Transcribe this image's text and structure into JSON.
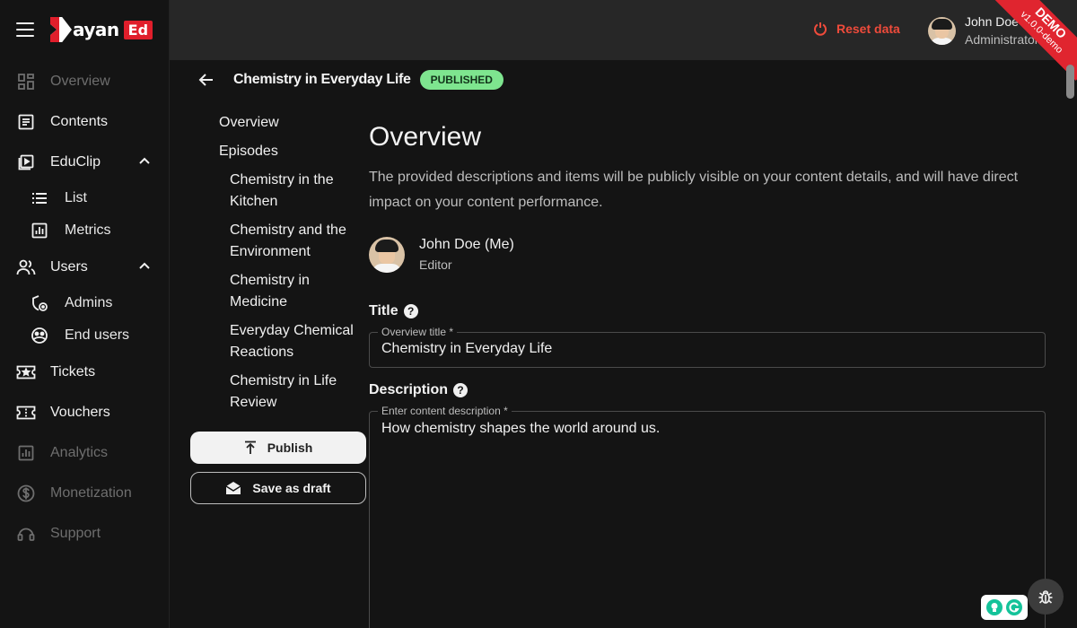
{
  "brand": {
    "logo_text": "ayan",
    "logo_badge": "Ed"
  },
  "sidebar": {
    "items": [
      {
        "label": "Overview",
        "icon": "dashboard-icon",
        "dim": true
      },
      {
        "label": "Contents",
        "icon": "document-icon"
      },
      {
        "label": "EduClip",
        "icon": "video-icon",
        "expanded": true,
        "children": [
          {
            "label": "List",
            "icon": "list-icon"
          },
          {
            "label": "Metrics",
            "icon": "bar-chart-icon"
          }
        ]
      },
      {
        "label": "Users",
        "icon": "users-icon",
        "expanded": true,
        "children": [
          {
            "label": "Admins",
            "icon": "admin-shield-icon"
          },
          {
            "label": "End users",
            "icon": "user-face-icon"
          }
        ]
      },
      {
        "label": "Tickets",
        "icon": "ticket-icon"
      },
      {
        "label": "Vouchers",
        "icon": "voucher-icon"
      },
      {
        "label": "Analytics",
        "icon": "analytics-icon",
        "dim": true
      },
      {
        "label": "Monetization",
        "icon": "dollar-icon",
        "dim": true
      },
      {
        "label": "Support",
        "icon": "support-icon",
        "dim": true
      }
    ]
  },
  "topbar": {
    "reset_label": "Reset data",
    "user_name": "John Doe",
    "user_role": "Administrator",
    "ribbon": {
      "text": "DEMO",
      "version": "v1.0.0-demo"
    }
  },
  "content": {
    "title": "Chemistry in Everyday Life",
    "status": "PUBLISHED",
    "status_color": "#7ee58f"
  },
  "subnav": {
    "overview": "Overview",
    "episodes": "Episodes",
    "episode_items": [
      "Chemistry in the Kitchen",
      "Chemistry and the Environment",
      "Chemistry in Medicine",
      "Everyday Chemical Reactions",
      "Chemistry in Life Review"
    ],
    "publish_label": "Publish",
    "draft_label": "Save as draft"
  },
  "main": {
    "heading": "Overview",
    "description": "The provided descriptions and items will be publicly visible on your content details, and will have direct impact on your content performance.",
    "author_name": "John Doe (Me)",
    "author_role": "Editor",
    "title_label": "Title",
    "title_field_label": "Overview title *",
    "title_value": "Chemistry in Everyday Life",
    "desc_label": "Description",
    "desc_field_label": "Enter content description *",
    "desc_value": "How chemistry shapes the world around us."
  },
  "colors": {
    "accent_red": "#e01e2b",
    "reset_red": "#ef4b3b",
    "topbar": "#272727",
    "background": "#141414"
  }
}
